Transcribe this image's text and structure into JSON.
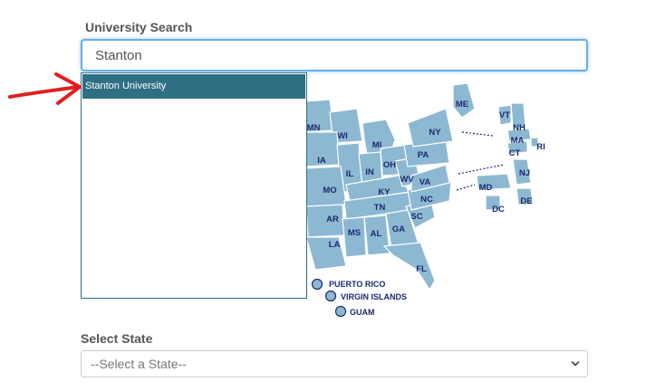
{
  "search": {
    "label": "University Search",
    "value": "Stanton"
  },
  "dropdown": {
    "items": [
      "Stanton University"
    ]
  },
  "map": {
    "states": [
      "ME",
      "VT",
      "NH",
      "MA",
      "RI",
      "CT",
      "NY",
      "NJ",
      "PA",
      "DE",
      "MD",
      "DC",
      "MN",
      "WI",
      "MI",
      "IA",
      "IL",
      "IN",
      "OH",
      "WV",
      "VA",
      "MO",
      "KY",
      "NC",
      "TN",
      "AR",
      "SC",
      "MS",
      "AL",
      "GA",
      "LA",
      "FL"
    ],
    "territories": [
      "PUERTO RICO",
      "VIRGIN ISLANDS",
      "GUAM"
    ],
    "fill_color": "#8db8d2",
    "label_color": "#1c2a6e"
  },
  "state_select": {
    "label": "Select State",
    "selected": "--Select a State--"
  },
  "annotation": {
    "arrow_color": "#e02020"
  }
}
